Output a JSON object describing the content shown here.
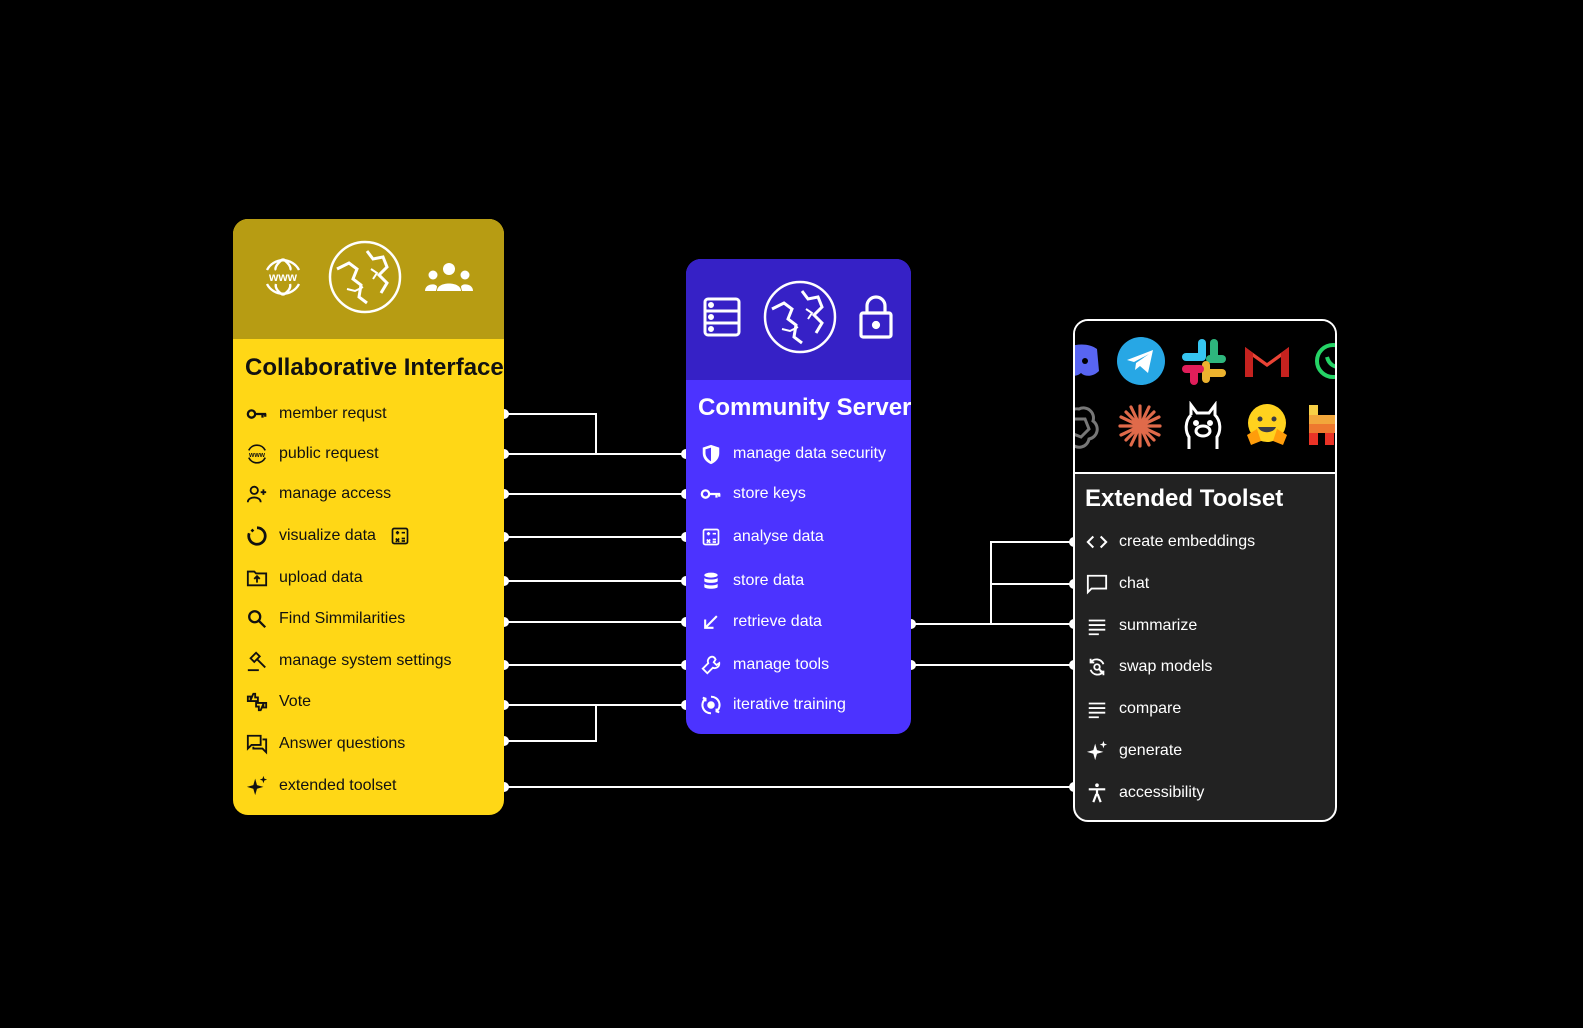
{
  "collaborative_interface": {
    "title": "Collaborative Interface",
    "header_icons": [
      "www-globe-icon",
      "world-globe-icon",
      "group-icon"
    ],
    "items": [
      {
        "label": "member requst",
        "icon": "key-icon"
      },
      {
        "label": "public request",
        "icon": "www-icon"
      },
      {
        "label": "manage access",
        "icon": "person-add-icon"
      },
      {
        "label": "visualize data",
        "icon": "donut-chart-icon",
        "extra_icon": "calculator-icon"
      },
      {
        "label": "upload data",
        "icon": "folder-upload-icon"
      },
      {
        "label": "Find Simmilarities",
        "icon": "search-icon"
      },
      {
        "label": "manage system settings",
        "icon": "gavel-icon"
      },
      {
        "label": "Vote",
        "icon": "thumbs-icon"
      },
      {
        "label": "Answer questions",
        "icon": "forum-icon"
      },
      {
        "label": "extended toolset",
        "icon": "sparkle-icon"
      }
    ],
    "colors": {
      "body": "#FFD716",
      "header": "#B79C13"
    }
  },
  "community_server": {
    "title": "Community Server",
    "header_icons": [
      "server-icon",
      "world-globe-icon",
      "lock-icon"
    ],
    "items": [
      {
        "label": "manage data security",
        "icon": "shield-icon"
      },
      {
        "label": "store keys",
        "icon": "key-icon"
      },
      {
        "label": "analyse data",
        "icon": "calculator-icon"
      },
      {
        "label": "store data",
        "icon": "database-icon"
      },
      {
        "label": "retrieve data",
        "icon": "arrow-down-left-icon"
      },
      {
        "label": "manage tools",
        "icon": "wrench-icon"
      },
      {
        "label": "iterative training",
        "icon": "cycle-icon"
      }
    ],
    "colors": {
      "body": "#4C33FF",
      "header": "#3621C6"
    }
  },
  "extended_toolset": {
    "title": "Extended Toolset",
    "header_icons": [
      "discord-icon",
      "telegram-icon",
      "slack-icon",
      "gmail-icon",
      "whatsapp-icon",
      "openai-icon",
      "anthropic-icon",
      "ollama-icon",
      "huggingface-icon",
      "mistral-icon"
    ],
    "items": [
      {
        "label": "create embeddings",
        "icon": "code-icon"
      },
      {
        "label": "chat",
        "icon": "chat-icon"
      },
      {
        "label": "summarize",
        "icon": "lines-icon"
      },
      {
        "label": "swap models",
        "icon": "swap-icon"
      },
      {
        "label": "compare",
        "icon": "lines-icon"
      },
      {
        "label": "generate",
        "icon": "sparkle-icon"
      },
      {
        "label": "accessibility",
        "icon": "accessibility-icon"
      }
    ],
    "colors": {
      "body": "#222222",
      "header": "#000000",
      "border": "#FFFFFF"
    }
  }
}
